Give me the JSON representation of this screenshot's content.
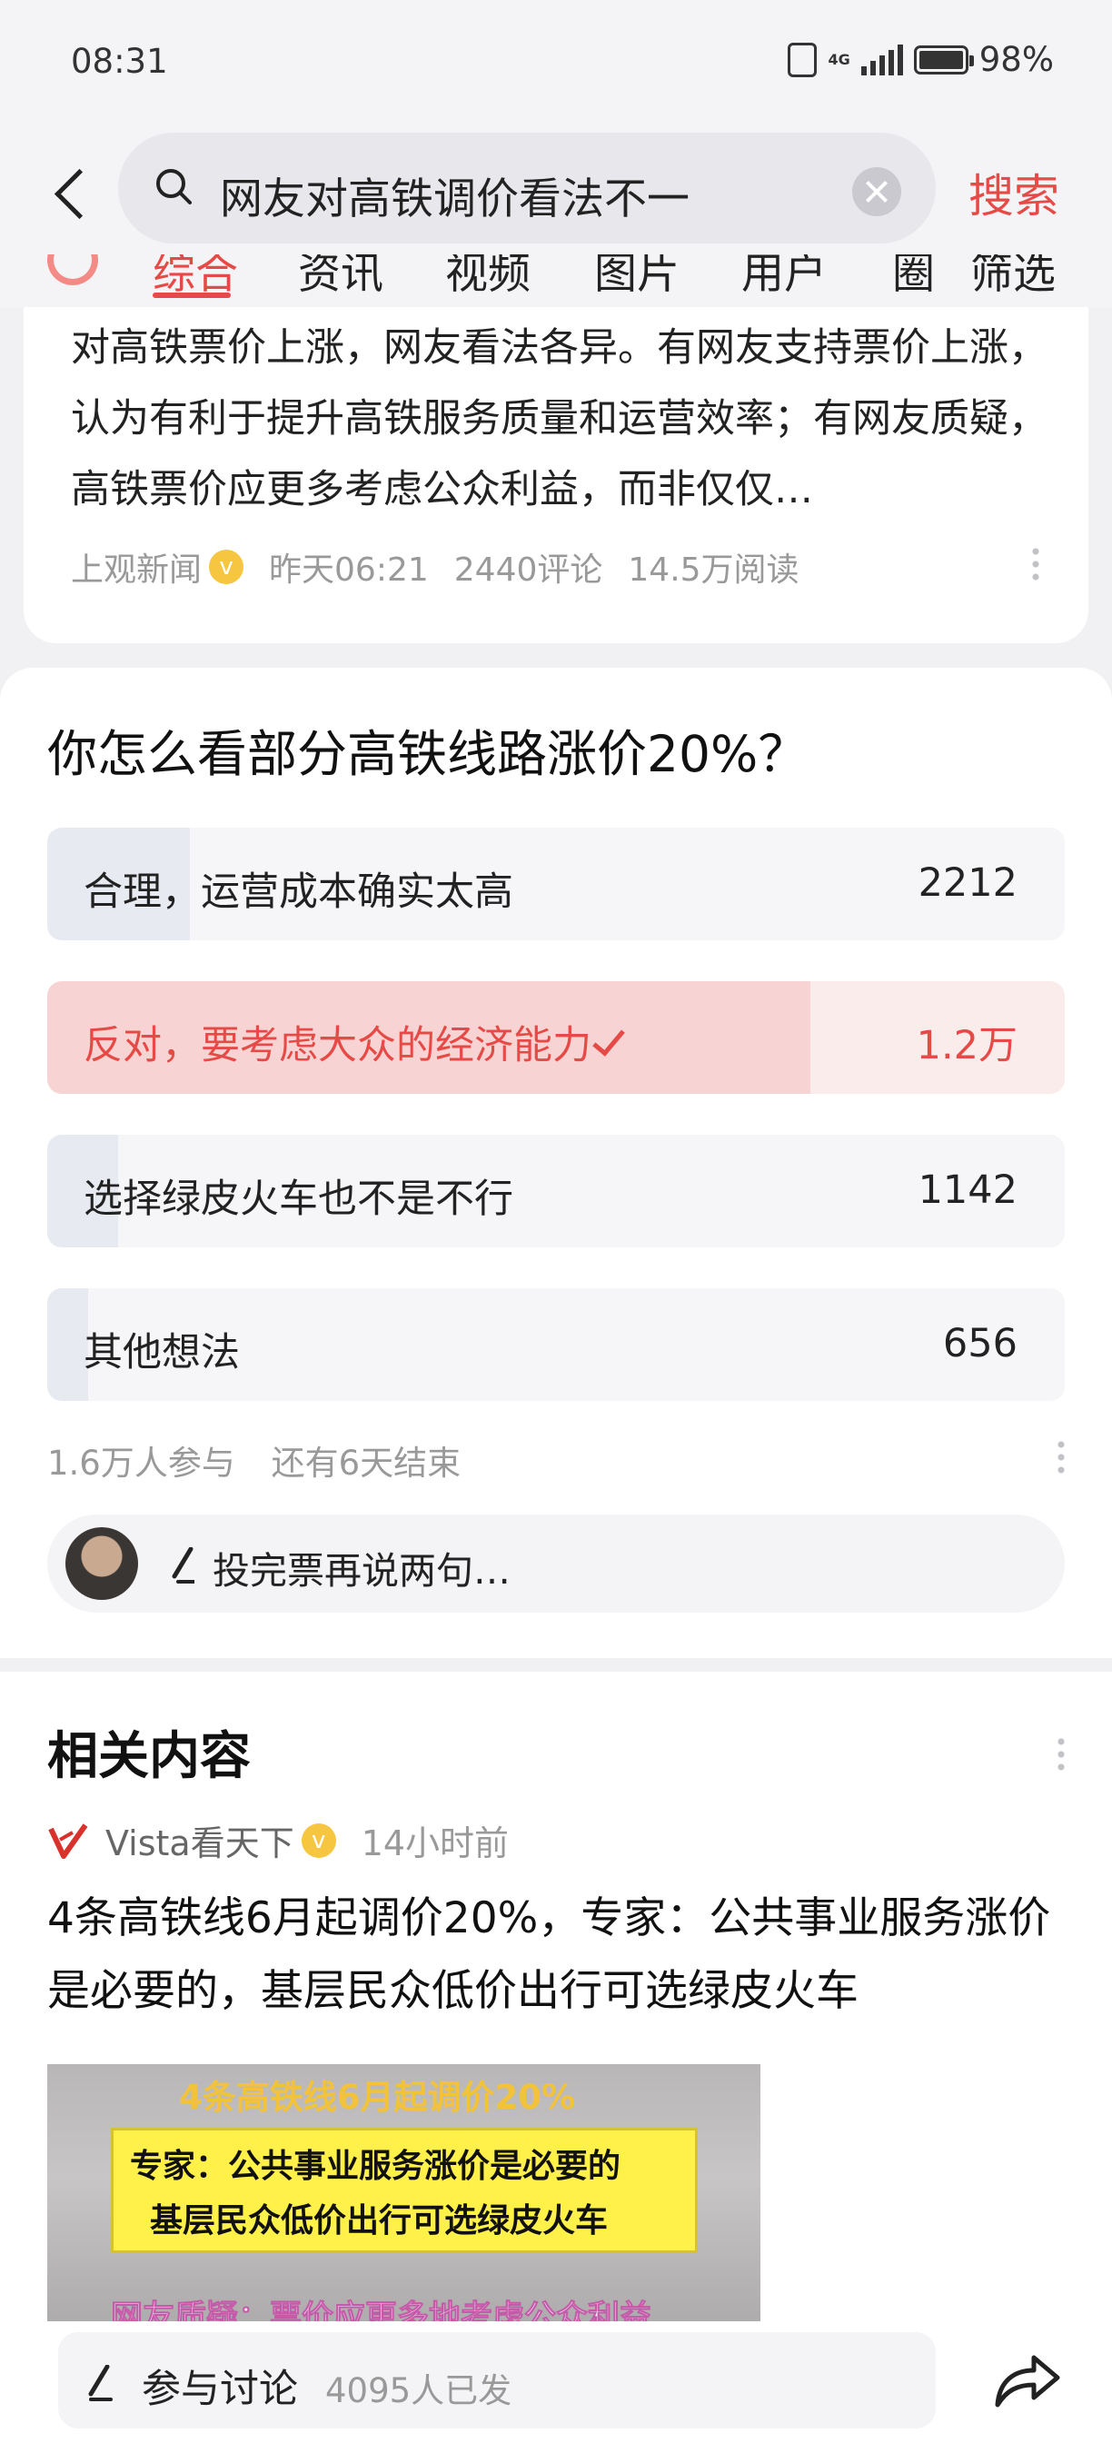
{
  "status_bar": {
    "time": "08:31",
    "network": "4G",
    "battery": "98%"
  },
  "search": {
    "query": "网友对高铁调价看法不一",
    "search_button": "搜索"
  },
  "tabs": [
    "综合",
    "资讯",
    "视频",
    "图片",
    "用户",
    "圈",
    "筛选"
  ],
  "article": {
    "snippet": "对高铁票价上涨，网友看法各异。有网友支持票价上涨，认为有利于提升高铁服务质量和运营效率；有网友质疑，高铁票价应更多考虑公众利益，而非仅仅…",
    "source": "上观新闻",
    "time": "昨天06:21",
    "comments": "2440评论",
    "reads": "14.5万阅读"
  },
  "poll": {
    "question": "你怎么看部分高铁线路涨价20%？",
    "options": [
      {
        "label": "合理，运营成本确实太高",
        "count": "2212",
        "fraction": 0.14,
        "chosen": false
      },
      {
        "label": "反对，要考虑大众的经济能力",
        "count": "1.2万",
        "fraction": 0.75,
        "chosen": true
      },
      {
        "label": "选择绿皮火车也不是不行",
        "count": "1142",
        "fraction": 0.07,
        "chosen": false
      },
      {
        "label": "其他想法",
        "count": "656",
        "fraction": 0.04,
        "chosen": false
      }
    ],
    "participants": "1.6万人参与",
    "remaining": "还有6天结束",
    "comment_placeholder": "投完票再说两句…"
  },
  "related": {
    "title": "相关内容",
    "source": "Vista看天下",
    "time": "14小时前",
    "headline": "4条高铁线6月起调价20%，专家：公共事业服务涨价是必要的，基层民众低价出行可选绿皮火车",
    "thumbnail": {
      "line1": "4条高铁线6月起调价20%",
      "line2": "专家：公共事业服务涨价是必要的",
      "line3": "基层民众低价出行可选绿皮火车",
      "line4": "网友质疑：票价应更多地考虑公众利益"
    }
  },
  "bottom_bar": {
    "discuss_label": "参与讨论",
    "discuss_count": "4095人已发"
  },
  "colors": {
    "accent": "#e64a46",
    "badge": "#f7c640",
    "background": "#f1f1f3"
  }
}
